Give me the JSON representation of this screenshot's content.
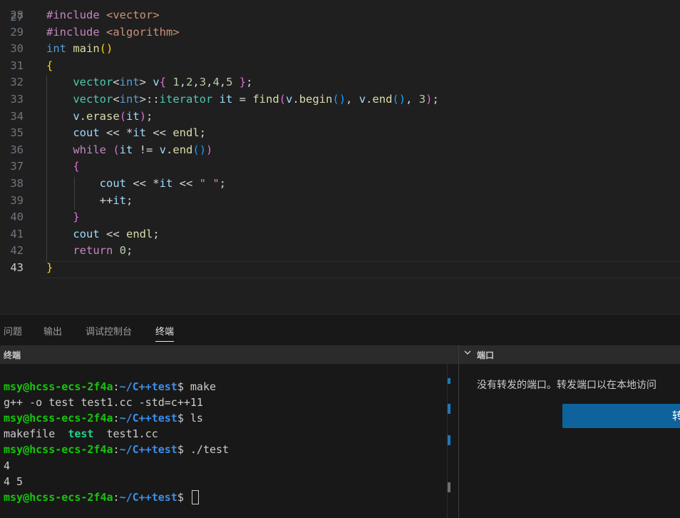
{
  "editor": {
    "first_line_number": "27",
    "lines": [
      {
        "no": "28",
        "code": [
          [
            "inc",
            "#include "
          ],
          [
            "hdr",
            "<vector>"
          ]
        ]
      },
      {
        "no": "29",
        "code": [
          [
            "inc",
            "#include "
          ],
          [
            "hdr",
            "<algorithm>"
          ]
        ]
      },
      {
        "no": "30",
        "code": [
          [
            "kw",
            "int "
          ],
          [
            "fn",
            "main"
          ],
          [
            "br1",
            "()"
          ]
        ]
      },
      {
        "no": "31",
        "code": [
          [
            "br1",
            "{"
          ]
        ]
      },
      {
        "no": "32",
        "code": [
          [
            "pl",
            "    "
          ],
          [
            "typ",
            "vector"
          ],
          [
            "pl",
            "<"
          ],
          [
            "kw",
            "int"
          ],
          [
            "pl",
            "> "
          ],
          [
            "var",
            "v"
          ],
          [
            "br2",
            "{"
          ],
          [
            "pl",
            " "
          ],
          [
            "num",
            "1"
          ],
          [
            "pl",
            ","
          ],
          [
            "num",
            "2"
          ],
          [
            "pl",
            ","
          ],
          [
            "num",
            "3"
          ],
          [
            "pl",
            ","
          ],
          [
            "num",
            "4"
          ],
          [
            "pl",
            ","
          ],
          [
            "num",
            "5"
          ],
          [
            "pl",
            " "
          ],
          [
            "br2",
            "}"
          ],
          [
            "pl",
            ";"
          ]
        ]
      },
      {
        "no": "33",
        "code": [
          [
            "pl",
            "    "
          ],
          [
            "typ",
            "vector"
          ],
          [
            "pl",
            "<"
          ],
          [
            "kw",
            "int"
          ],
          [
            "pl",
            ">::"
          ],
          [
            "typ",
            "iterator "
          ],
          [
            "var",
            "it"
          ],
          [
            "pl",
            " = "
          ],
          [
            "fn",
            "find"
          ],
          [
            "br2",
            "("
          ],
          [
            "var",
            "v"
          ],
          [
            "pl",
            "."
          ],
          [
            "fn",
            "begin"
          ],
          [
            "br3",
            "()"
          ],
          [
            "pl",
            ", "
          ],
          [
            "var",
            "v"
          ],
          [
            "pl",
            "."
          ],
          [
            "fn",
            "end"
          ],
          [
            "br3",
            "()"
          ],
          [
            "pl",
            ", "
          ],
          [
            "num",
            "3"
          ],
          [
            "br2",
            ")"
          ],
          [
            "pl",
            ";"
          ]
        ]
      },
      {
        "no": "34",
        "code": [
          [
            "pl",
            "    "
          ],
          [
            "var",
            "v"
          ],
          [
            "pl",
            "."
          ],
          [
            "fn",
            "erase"
          ],
          [
            "br2",
            "("
          ],
          [
            "var",
            "it"
          ],
          [
            "br2",
            ")"
          ],
          [
            "pl",
            ";"
          ]
        ]
      },
      {
        "no": "35",
        "code": [
          [
            "pl",
            "    "
          ],
          [
            "var",
            "cout"
          ],
          [
            "pl",
            " << *"
          ],
          [
            "var",
            "it"
          ],
          [
            "pl",
            " << "
          ],
          [
            "fn",
            "endl"
          ],
          [
            "pl",
            ";"
          ]
        ]
      },
      {
        "no": "36",
        "code": [
          [
            "pl",
            "    "
          ],
          [
            "ctl",
            "while "
          ],
          [
            "br2",
            "("
          ],
          [
            "var",
            "it"
          ],
          [
            "pl",
            " != "
          ],
          [
            "var",
            "v"
          ],
          [
            "pl",
            "."
          ],
          [
            "fn",
            "end"
          ],
          [
            "br3",
            "()"
          ],
          [
            "br2",
            ")"
          ]
        ]
      },
      {
        "no": "37",
        "code": [
          [
            "pl",
            "    "
          ],
          [
            "br2",
            "{"
          ]
        ]
      },
      {
        "no": "38",
        "code": [
          [
            "pl",
            "        "
          ],
          [
            "var",
            "cout"
          ],
          [
            "pl",
            " << *"
          ],
          [
            "var",
            "it"
          ],
          [
            "pl",
            " << "
          ],
          [
            "str",
            "\" \""
          ],
          [
            "pl",
            ";"
          ]
        ]
      },
      {
        "no": "39",
        "code": [
          [
            "pl",
            "        ++"
          ],
          [
            "var",
            "it"
          ],
          [
            "pl",
            ";"
          ]
        ]
      },
      {
        "no": "40",
        "code": [
          [
            "pl",
            "    "
          ],
          [
            "br2",
            "}"
          ]
        ]
      },
      {
        "no": "41",
        "code": [
          [
            "pl",
            "    "
          ],
          [
            "var",
            "cout"
          ],
          [
            "pl",
            " << "
          ],
          [
            "fn",
            "endl"
          ],
          [
            "pl",
            ";"
          ]
        ]
      },
      {
        "no": "42",
        "code": [
          [
            "pl",
            "    "
          ],
          [
            "ctl",
            "return "
          ],
          [
            "num",
            "0"
          ],
          [
            "pl",
            ";"
          ]
        ]
      },
      {
        "no": "43",
        "code": [
          [
            "br1",
            "}"
          ]
        ]
      }
    ]
  },
  "panel": {
    "tabs": [
      {
        "label": "问题",
        "active": false
      },
      {
        "label": "输出",
        "active": false
      },
      {
        "label": "调试控制台",
        "active": false
      },
      {
        "label": "终端",
        "active": true
      }
    ]
  },
  "terminal": {
    "header": "终端",
    "user_host": "msy@hcss-ecs-2f4a",
    "path": "~/C++test",
    "lines": [
      {
        "prompt": true,
        "cmd": " make"
      },
      {
        "text": "g++ -o test test1.cc -std=c++11"
      },
      {
        "prompt": true,
        "cmd": " ls"
      },
      {
        "files": [
          {
            "name": "makefile",
            "exe": false
          },
          {
            "name": "test",
            "exe": true
          },
          {
            "name": "test1.cc",
            "exe": false
          }
        ]
      },
      {
        "prompt": true,
        "cmd": " ./test"
      },
      {
        "text": "4"
      },
      {
        "text": "4 5"
      },
      {
        "prompt": true,
        "cmd": " ",
        "cursor": true
      }
    ]
  },
  "ports": {
    "header": "端口",
    "message": "没有转发的端口。转发端口以在本地访问",
    "button_label": "转"
  },
  "colors": {
    "editor_bg": "#1f1f1f",
    "panel_bg": "#181818",
    "accent_button": "#0e639c"
  }
}
